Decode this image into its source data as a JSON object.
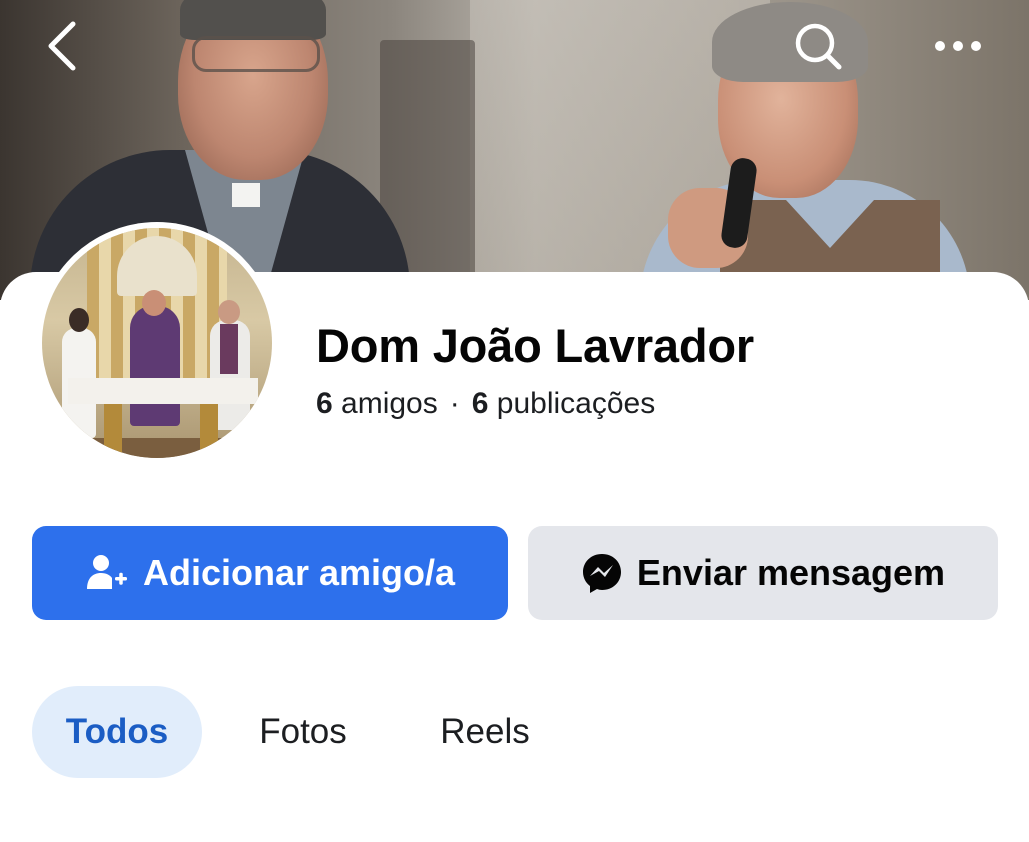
{
  "header": {
    "back_icon": "chevron-left-icon",
    "search_icon": "search-icon",
    "more_icon": "more-horizontal-icon"
  },
  "profile": {
    "name": "Dom João Lavrador",
    "friends_count": "6",
    "friends_label": "amigos",
    "separator": "·",
    "posts_count": "6",
    "posts_label": "publicações"
  },
  "actions": {
    "add_friend_label": "Adicionar amigo/a",
    "add_friend_icon": "add-person-icon",
    "message_label": "Enviar mensagem",
    "message_icon": "messenger-icon"
  },
  "tabs": [
    {
      "label": "Todos",
      "active": true
    },
    {
      "label": "Fotos",
      "active": false
    },
    {
      "label": "Reels",
      "active": false
    }
  ],
  "colors": {
    "primary_button": "#2d70ec",
    "secondary_button": "#e4e6eb",
    "active_tab_bg": "#e1edfb",
    "active_tab_text": "#1b5dc4"
  }
}
